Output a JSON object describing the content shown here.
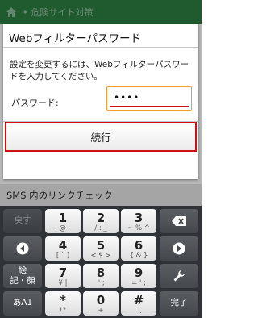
{
  "appbar": {
    "title": "危険サイト対策"
  },
  "dialog": {
    "title": "Webフィルターパスワード",
    "message": "設定を変更するには、Webフィルターパスワードを入力してください。",
    "password_label": "パスワード:",
    "password_value": "••••",
    "continue_label": "続行"
  },
  "background": {
    "row_label": "SMS 内のリンクチェック"
  },
  "keyboard": {
    "back_label": "戻す",
    "enter_label": "完了",
    "kana_label": "絵\n記・顔",
    "mode_label": "あA1",
    "keys": [
      {
        "main": "1",
        "sub": ". @ -"
      },
      {
        "main": "2",
        "sub": "/ : _"
      },
      {
        "main": "3",
        "sub": "~ % ^"
      },
      {
        "main": "4",
        "sub": "[ ` ]"
      },
      {
        "main": "5",
        "sub": "< $ >"
      },
      {
        "main": "6",
        "sub": "{ & }"
      },
      {
        "main": "7",
        "sub": "¥ |"
      },
      {
        "main": "8",
        "sub": "\" ;"
      },
      {
        "main": "9",
        "sub": "= ' ;"
      },
      {
        "main": "*",
        "sub": "!?"
      },
      {
        "main": "0",
        "sub": "+"
      },
      {
        "main": "#",
        "sub": ". ,"
      }
    ]
  }
}
